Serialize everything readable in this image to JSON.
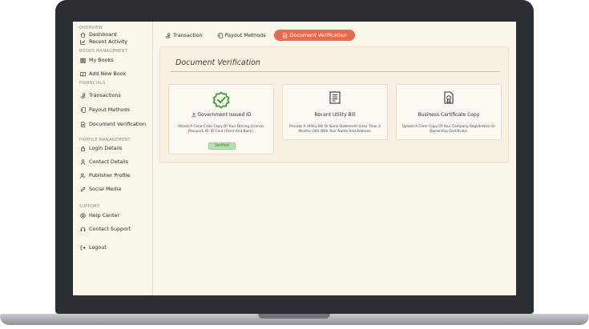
{
  "sidebar": {
    "sections": [
      {
        "title": "Overview",
        "items": [
          {
            "label": "Dashboard",
            "icon": "home-icon"
          },
          {
            "label": "Recent Activity",
            "icon": "chart-icon"
          }
        ]
      },
      {
        "title": "Books Management",
        "items": [
          {
            "label": "My Books",
            "icon": "books-icon"
          },
          {
            "label": "Add New Book",
            "icon": "open-book-icon"
          }
        ]
      },
      {
        "title": "Financials",
        "items": [
          {
            "label": "Transactions",
            "icon": "hand-coin-icon"
          },
          {
            "label": "Payout Methods",
            "icon": "payout-icon"
          },
          {
            "label": "Document Verification",
            "icon": "document-icon"
          }
        ]
      },
      {
        "title": "Profile Management",
        "items": [
          {
            "label": "Login Details",
            "icon": "lock-icon"
          },
          {
            "label": "Contact Details",
            "icon": "user-icon"
          },
          {
            "label": "Publisher Profile",
            "icon": "publisher-icon"
          },
          {
            "label": "Social Media",
            "icon": "link-icon"
          }
        ]
      },
      {
        "title": "Support",
        "items": [
          {
            "label": "Help Center",
            "icon": "help-icon"
          },
          {
            "label": "Contact Support",
            "icon": "headset-icon"
          }
        ]
      }
    ],
    "logout": "Logout"
  },
  "tabs": [
    {
      "label": "Transaction",
      "active": false
    },
    {
      "label": "Payout Methods",
      "active": false
    },
    {
      "label": "Document Verification",
      "active": true
    }
  ],
  "panel": {
    "title": "Document Verification",
    "cards": [
      {
        "title": "Government Issued ID",
        "description": "Attach A Clear Color Copy Of Your Driving License, Passport, Or ID Card (Front And Back).",
        "status": "Verified",
        "icon": "verified-badge-icon"
      },
      {
        "title": "Recent Utility Bill",
        "description": "Provide A Utility Bill Or Bank Statement (Less Than 3 Months Old) With Your Name And Address.",
        "icon": "receipt-icon"
      },
      {
        "title": "Business Certificate Copy",
        "description": "Upload A Clear Copy Of Your Company Registration Or Ownership Certificate.",
        "icon": "certificate-icon"
      }
    ]
  },
  "colors": {
    "accent": "#e46c52",
    "background": "#fbf6ea",
    "verified": "#3e9a3a"
  }
}
